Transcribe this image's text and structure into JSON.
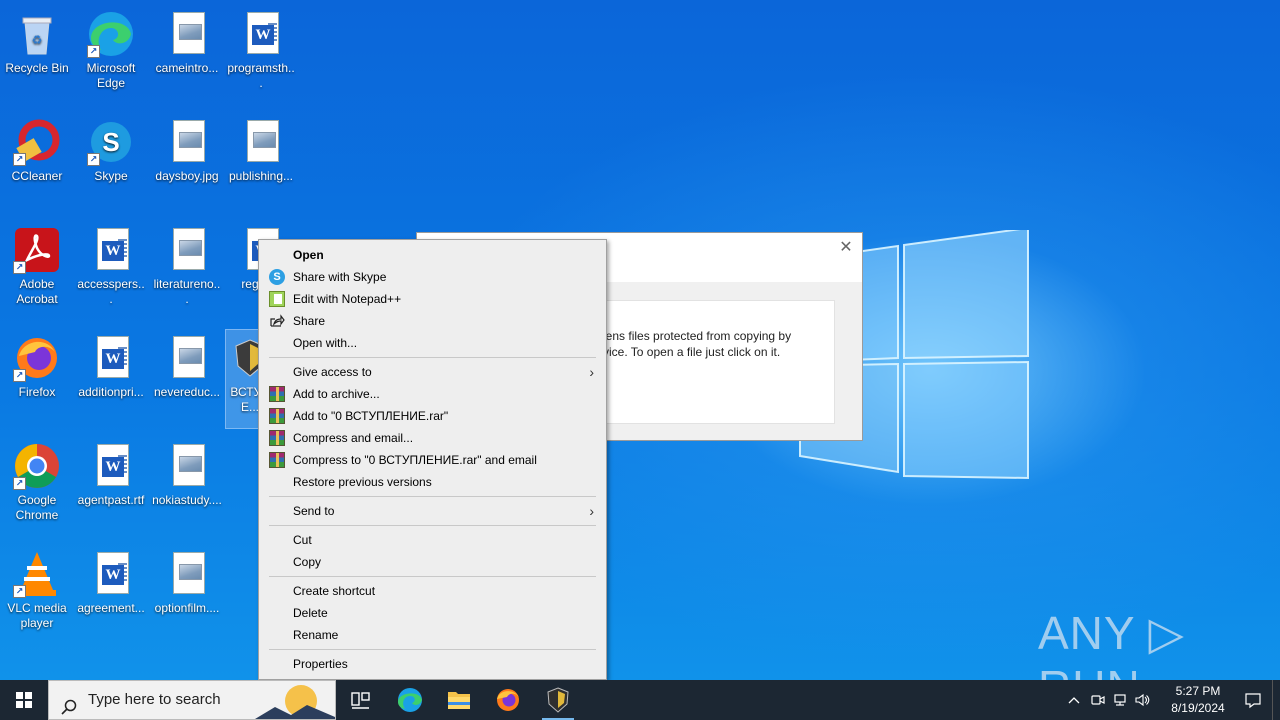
{
  "desktop": {
    "icons": [
      {
        "label": "Recycle Bin"
      },
      {
        "label": "Microsoft Edge"
      },
      {
        "label": "cameintro..."
      },
      {
        "label": "programsth..."
      },
      {
        "label": "CCleaner"
      },
      {
        "label": "Skype"
      },
      {
        "label": "daysboy.jpg"
      },
      {
        "label": "publishing..."
      },
      {
        "label": "Adobe Acrobat"
      },
      {
        "label": "accesspers..."
      },
      {
        "label": "literatureno..."
      },
      {
        "label": "regist..."
      },
      {
        "label": "Firefox"
      },
      {
        "label": "additionpri..."
      },
      {
        "label": "nevereduc..."
      },
      {
        "label": "ВСТУ... E..."
      },
      {
        "label": "Google Chrome"
      },
      {
        "label": "agentpast.rtf"
      },
      {
        "label": "nokiastudy...."
      },
      {
        "label": "VLC media player"
      },
      {
        "label": "agreement..."
      },
      {
        "label": "optionfilm...."
      }
    ]
  },
  "dialog": {
    "close_glyph": "✕",
    "message": "pens files protected from copying by rvice. To open a file just click on it."
  },
  "context_menu": {
    "items": [
      {
        "label": "Open"
      },
      {
        "label": "Share with Skype"
      },
      {
        "label": "Edit with Notepad++"
      },
      {
        "label": "Share"
      },
      {
        "label": "Open with..."
      },
      {
        "label": "Give access to"
      },
      {
        "label": "Add to archive..."
      },
      {
        "label": "Add to \"0 ВСТУПЛЕНИЕ.rar\""
      },
      {
        "label": "Compress and email..."
      },
      {
        "label": "Compress to \"0 ВСТУПЛЕНИЕ.rar\" and email"
      },
      {
        "label": "Restore previous versions"
      },
      {
        "label": "Send to"
      },
      {
        "label": "Cut"
      },
      {
        "label": "Copy"
      },
      {
        "label": "Create shortcut"
      },
      {
        "label": "Delete"
      },
      {
        "label": "Rename"
      },
      {
        "label": "Properties"
      }
    ]
  },
  "watermark": {
    "text": "ANY ▷ RUN"
  },
  "taskbar": {
    "search_placeholder": "Type here to search",
    "clock_time": "5:27 PM",
    "clock_date": "8/19/2024",
    "apps": [
      "task-view-icon",
      "edge-icon",
      "file-explorer-icon",
      "firefox-icon",
      "shield-app-icon"
    ]
  },
  "colors": {
    "taskbar": "#1c2733",
    "desktop": "#0a6fd8",
    "menu_bg": "#eeeeee"
  }
}
